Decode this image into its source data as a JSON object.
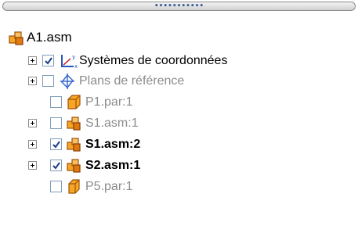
{
  "splitter": {
    "grip": "•••••••••••"
  },
  "tree": {
    "root": {
      "label": "A1.asm",
      "icon": "assembly-icon"
    },
    "items": [
      {
        "label": "Systèmes de coordonnées",
        "icon": "coordinate-system-icon",
        "checked": true,
        "expandable": true,
        "state": "active"
      },
      {
        "label": "Plans de référence",
        "icon": "reference-plane-icon",
        "checked": false,
        "expandable": true,
        "state": "dim"
      },
      {
        "label": "P1.par:1",
        "icon": "part-icon",
        "checked": false,
        "expandable": false,
        "state": "dim"
      },
      {
        "label": "S1.asm:1",
        "icon": "subassembly-icon",
        "checked": false,
        "expandable": true,
        "state": "dim"
      },
      {
        "label": "S1.asm:2",
        "icon": "subassembly-icon",
        "checked": true,
        "expandable": true,
        "state": "active"
      },
      {
        "label": "S2.asm:1",
        "icon": "subassembly-icon",
        "checked": true,
        "expandable": true,
        "state": "active"
      },
      {
        "label": "P5.par:1",
        "icon": "part-icon",
        "checked": false,
        "expandable": false,
        "state": "dim"
      }
    ]
  },
  "colors": {
    "active_text": "#000000",
    "dim_text": "#8c8c8c",
    "check": "#1a3a8a",
    "icon_orange": "#e07a10"
  }
}
